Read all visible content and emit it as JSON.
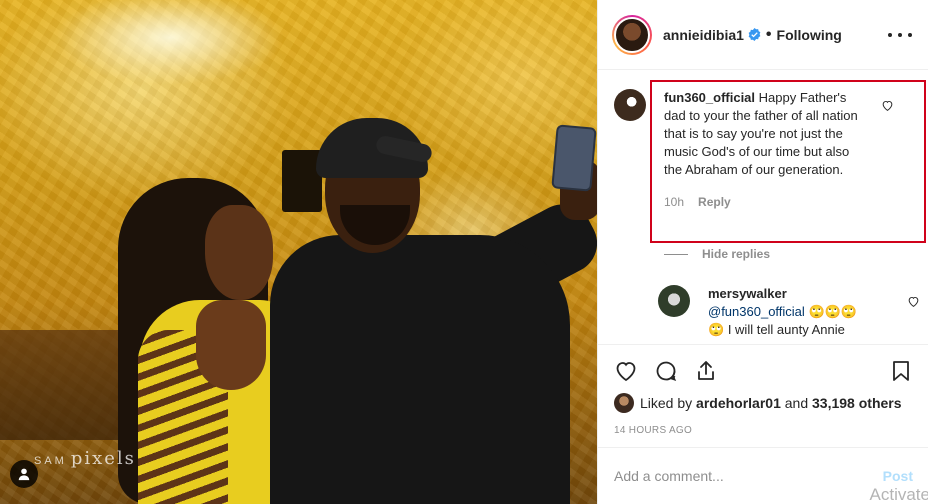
{
  "photo": {
    "watermark": {
      "prefix": "SAM",
      "script": "pixels"
    },
    "tag_icon": "user-icon"
  },
  "header": {
    "username": "annieidibia1",
    "verified_icon": "verified-badge-icon",
    "separator": "•",
    "follow_status": "Following",
    "more_icon": "more-options-icon"
  },
  "comments": [
    {
      "username": "fun360_official",
      "text": "Happy Father's dad to your the father of all nation that is to say you're not just the music God's of our time but also the Abraham of our generation.",
      "time": "10h",
      "reply_label": "Reply",
      "highlighted": true
    }
  ],
  "replies_toggle": "Hide replies",
  "reply": {
    "username": "mersywalker",
    "mention": "@fun360_official",
    "emoji_line_1": "🙄🙄🙄",
    "emoji_line_2": "🙄",
    "text": "I will tell aunty Annie"
  },
  "actions": {
    "like_icon": "heart-icon",
    "comment_icon": "comment-icon",
    "share_icon": "share-icon",
    "save_icon": "bookmark-icon"
  },
  "likes": {
    "prefix": "Liked by",
    "user": "ardehorlar01",
    "joiner": "and",
    "others": "33,198 others"
  },
  "timestamp": "14 HOURS AGO",
  "comment_box": {
    "placeholder": "Add a comment...",
    "post_label": "Post"
  },
  "os_overlay": "Activate",
  "colors": {
    "highlight_border": "#d0021b",
    "post_disabled": "#b2dffc",
    "verified": "#3897f0",
    "muted": "#8e8e8e"
  }
}
